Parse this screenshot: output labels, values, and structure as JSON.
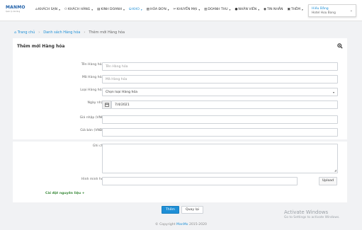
{
  "brand": {
    "logo_text": "MANMO",
    "logo_tagline": "Quản lý cửa hàng"
  },
  "nav": {
    "items": [
      {
        "label": "KHÁCH SẠN",
        "icon": "house-icon"
      },
      {
        "label": "KHÁCH HÀNG",
        "icon": "users-icon"
      },
      {
        "label": "KINH DOANH",
        "icon": "chart-icon"
      },
      {
        "label": "KHO",
        "icon": "warehouse-icon",
        "active": true
      },
      {
        "label": "HÓA ĐƠN",
        "icon": "invoice-icon"
      },
      {
        "label": "KHUYẾN MẠI",
        "icon": "tag-icon"
      },
      {
        "label": "DOANH THU",
        "icon": "revenue-icon"
      },
      {
        "label": "NHÂN VIÊN",
        "icon": "user-icon"
      },
      {
        "label": "TIN NHẮN",
        "icon": "message-icon"
      },
      {
        "label": "THÊM",
        "icon": "more-icon"
      }
    ]
  },
  "user": {
    "name": "Hiếu Bằng",
    "branch": "Hotel Hưu Bang"
  },
  "breadcrumb": {
    "home": "Trang chủ",
    "list": "Danh sách Hàng hóa",
    "current": "Thêm mới Hàng hóa"
  },
  "form": {
    "title": "Thêm mới Hàng hóa",
    "name_label": "Tên Hàng hóa*:",
    "name_placeholder": "Tên Hàng hóa",
    "code_label": "Mã Hàng hóa*:",
    "code_placeholder": "Mã Hàng hóa",
    "type_label": "Loại Hàng hóa*:",
    "type_value": "Chọn loại Hàng hóa",
    "date_label": "Ngày nhập:",
    "date_value": "7/4/2021",
    "buy_label": "Giá nhập (VNĐ):",
    "sell_label": "Giá bán (VNĐ)*:",
    "note_label": "Ghi chú:",
    "image_label": "Hình minh họa:",
    "upload_label": "Upload",
    "advanced_label": "Cài đặt nguyên liệu +"
  },
  "actions": {
    "submit": "Thêm",
    "back": "Quay lại"
  },
  "footer": {
    "copyright": "© Copyright",
    "brand": "ManMo",
    "years": "2015-2020"
  },
  "watermark": {
    "title": "Activate Windows",
    "subtitle": "Go to Settings to activate Windows."
  },
  "colors": {
    "accent": "#1e8fd6",
    "green": "#3a8a3a",
    "background": "#f1f2f4"
  }
}
